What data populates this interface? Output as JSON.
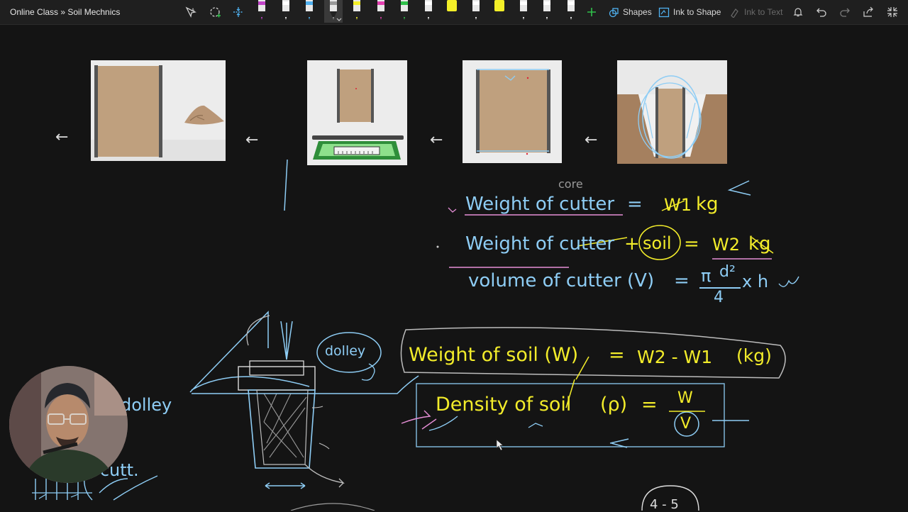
{
  "toolbar": {
    "title": "Online Class » Soil Mechnics",
    "shapes_label": "Shapes",
    "ink_to_shape_label": "Ink to Shape",
    "ink_to_text_label": "Ink to Text",
    "pens": [
      {
        "icon": "pen-icon",
        "color": "#c044c8"
      },
      {
        "icon": "pen-icon",
        "color": "#ffffff"
      },
      {
        "icon": "pen-icon",
        "color": "#4fb1f0"
      },
      {
        "icon": "pen-icon",
        "color": "#9a9a9a",
        "selected": true
      },
      {
        "icon": "pen-icon",
        "color": "#f3ef28"
      },
      {
        "icon": "pen-icon",
        "color": "#e33fb0"
      },
      {
        "icon": "pen-icon",
        "color": "#2fc04a"
      },
      {
        "icon": "pen-icon",
        "color": "#ffffff"
      },
      {
        "icon": "highlighter-icon",
        "color": "#f3ef28"
      },
      {
        "icon": "pen-icon",
        "color": "#ffffff"
      },
      {
        "icon": "highlighter-icon",
        "color": "#f3ef28"
      },
      {
        "icon": "pen-icon",
        "color": "#ffffff"
      },
      {
        "icon": "pen-icon",
        "color": "#ffffff"
      },
      {
        "icon": "pen-icon",
        "color": "#ffffff"
      }
    ],
    "icons": [
      "select-lasso-icon",
      "lasso-add-icon",
      "insert-space-icon",
      "add-pen-icon",
      "bell-icon",
      "undo-icon",
      "redo-icon",
      "share-icon",
      "exit-fullscreen-icon"
    ]
  },
  "canvas": {
    "diagram_arrows": [
      "←",
      "←",
      "←",
      "←"
    ],
    "notes": {
      "core_annotation": "core",
      "line1_label": "Weight of cutter",
      "line1_eq": "=",
      "line1_value": "W1",
      "line1_unit": "kg",
      "line2_label": "Weight of cutter",
      "line2_plus": "+",
      "line2_soil": "soil",
      "line2_eq": "=",
      "line2_value": "W2",
      "line2_unit": "kg",
      "line3_label": "volume of cutter (V)",
      "line3_eq": "=",
      "line3_pi": "π",
      "line3_d": "d²",
      "line3_den": "4",
      "line3_rest": "x h",
      "dolley_circle": "dolley",
      "dolley_left": "dolley",
      "cutt_label": "c cutt.",
      "weight_soil_label": "Weight of soil (W)",
      "weight_soil_eq": "=",
      "weight_soil_value": "W2 - W1",
      "weight_soil_unit": "(kg)",
      "density_label": "Density of soil",
      "density_symbol": "(ρ)",
      "density_eq": "=",
      "density_num": "W",
      "density_den": "V",
      "bottom_circle": "4 - 5"
    }
  },
  "colors": {
    "toolbar_bg": "#1f1f1f",
    "canvas_bg": "#141414",
    "ink_yellow": "#f2ec2a",
    "ink_blue": "#8ecdf5",
    "ink_pink": "#e68ed6",
    "soil_brown": "#bfa07e"
  }
}
